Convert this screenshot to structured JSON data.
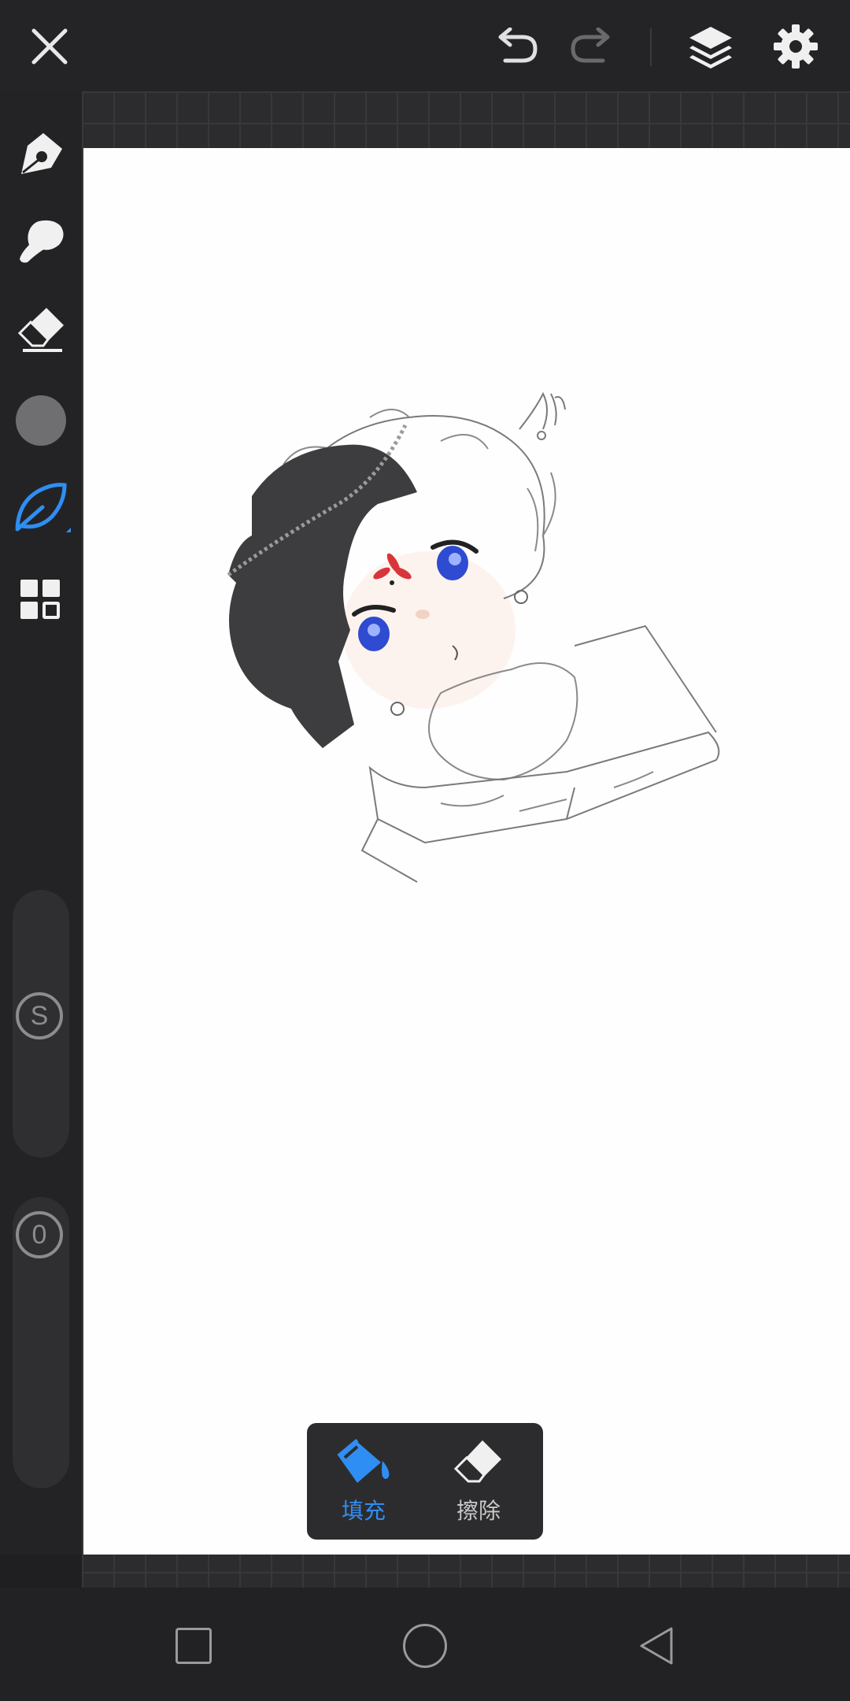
{
  "top_bar": {
    "close_icon": "close-icon",
    "undo_icon": "undo-icon",
    "redo_icon": "redo-icon",
    "layers_icon": "layers-icon",
    "settings_icon": "gear-icon"
  },
  "tools": [
    {
      "name": "pen",
      "icon": "pen-nib-icon",
      "active": false
    },
    {
      "name": "smudge",
      "icon": "brush-icon",
      "active": false
    },
    {
      "name": "eraser",
      "icon": "eraser-icon",
      "active": false
    },
    {
      "name": "color",
      "icon": "color-swatch",
      "color": "#6f6f71"
    },
    {
      "name": "fill",
      "icon": "leaf-icon",
      "active": true
    },
    {
      "name": "more",
      "icon": "grid-icon"
    }
  ],
  "sliders": {
    "size_label": "S",
    "opacity_label": "0"
  },
  "fill_popup": {
    "fill_label": "填充",
    "erase_label": "擦除",
    "active": "fill"
  },
  "colors": {
    "accent": "#2f8ef3",
    "toolbar_bg": "#232325",
    "canvas_bg": "#fefefe"
  },
  "nav_bar": {
    "recents_icon": "square-icon",
    "home_icon": "circle-icon",
    "back_icon": "triangle-back-icon"
  }
}
